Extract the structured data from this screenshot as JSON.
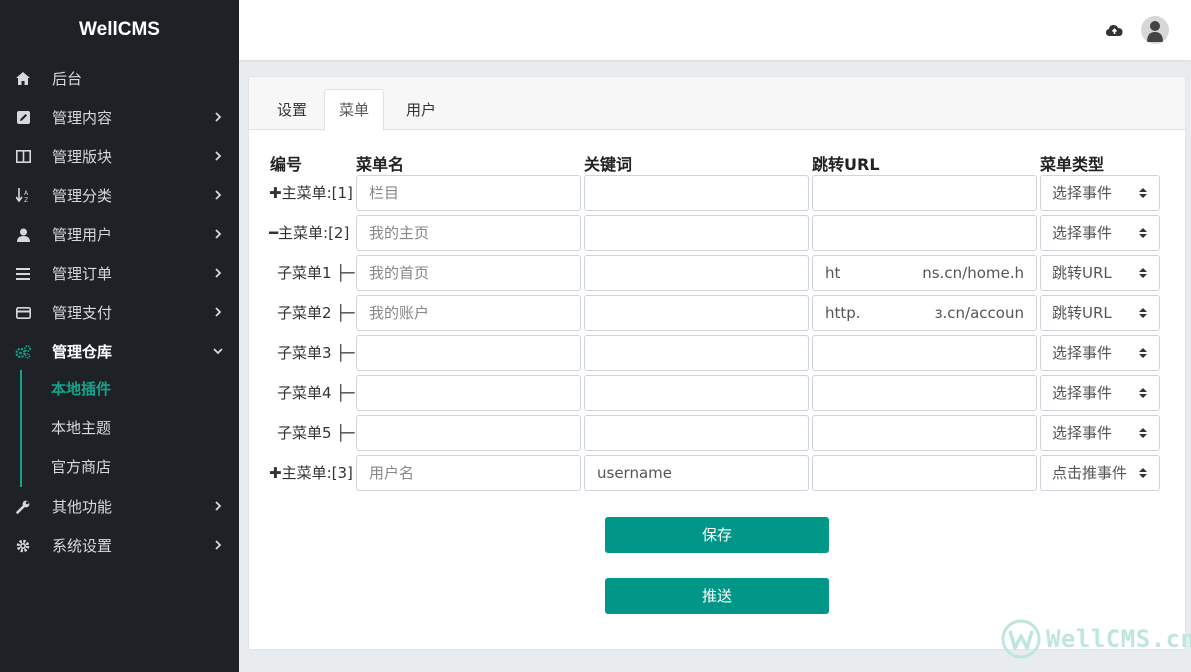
{
  "brand": "WellCMS",
  "sidebar": {
    "items": [
      {
        "label": "后台",
        "icon": "home-icon"
      },
      {
        "label": "管理内容",
        "icon": "edit-icon"
      },
      {
        "label": "管理版块",
        "icon": "columns-icon"
      },
      {
        "label": "管理分类",
        "icon": "sort-icon"
      },
      {
        "label": "管理用户",
        "icon": "user-icon"
      },
      {
        "label": "管理订单",
        "icon": "list-icon"
      },
      {
        "label": "管理支付",
        "icon": "credit-card-icon"
      },
      {
        "label": "管理仓库",
        "icon": "cogs-icon"
      },
      {
        "label": "其他功能",
        "icon": "wrench-icon"
      },
      {
        "label": "系统设置",
        "icon": "gear-icon"
      }
    ],
    "sub_items": [
      "本地插件",
      "本地主题",
      "官方商店"
    ]
  },
  "tabs": [
    "设置",
    "菜单",
    "用户"
  ],
  "table": {
    "headers": [
      "编号",
      "菜单名",
      "关键词",
      "跳转URL",
      "菜单类型"
    ],
    "rows": [
      {
        "label": "✚主菜单:[1]",
        "name": "",
        "name_ph": "栏目",
        "keyword": "",
        "url_left": "",
        "url_right": "",
        "type": "选择事件"
      },
      {
        "label": "━主菜单:[2]",
        "name": "",
        "name_ph": "我的主页",
        "keyword": "",
        "url_left": "",
        "url_right": "",
        "type": "选择事件"
      },
      {
        "label": "子菜单1 ├─",
        "name": "",
        "name_ph": "我的首页",
        "keyword": "",
        "url_left": "ht",
        "url_right": "ns.cn/home.h",
        "type": "跳转URL"
      },
      {
        "label": "子菜单2 ├─",
        "name": "",
        "name_ph": "我的账户",
        "keyword": "",
        "url_left": "http.",
        "url_right": "ɜ.cn/accoun",
        "type": "跳转URL"
      },
      {
        "label": "子菜单3 ├─",
        "name": "",
        "name_ph": "",
        "keyword": "",
        "url_left": "",
        "url_right": "",
        "type": "选择事件"
      },
      {
        "label": "子菜单4 ├─",
        "name": "",
        "name_ph": "",
        "keyword": "",
        "url_left": "",
        "url_right": "",
        "type": "选择事件"
      },
      {
        "label": "子菜单5 ├─",
        "name": "",
        "name_ph": "",
        "keyword": "",
        "url_left": "",
        "url_right": "",
        "type": "选择事件"
      },
      {
        "label": "✚主菜单:[3]",
        "name": "",
        "name_ph": "用户名",
        "keyword": "username",
        "url_left": "",
        "url_right": "",
        "type": "点击推事件"
      }
    ]
  },
  "buttons": {
    "save": "保存",
    "push": "推送"
  },
  "watermark": "WellCMS.cn",
  "colors": {
    "accent": "#009688",
    "sidebar_bg": "#1e2227",
    "active_green": "#14a38b"
  }
}
